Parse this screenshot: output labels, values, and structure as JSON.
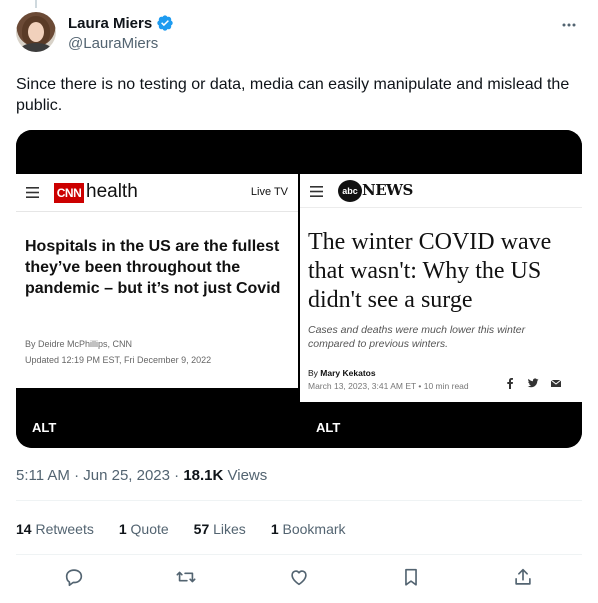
{
  "author": {
    "display_name": "Laura Miers",
    "handle": "@LauraMiers",
    "verified": true
  },
  "tweet": {
    "text": "Since there is no testing or data, media can easily manipulate and mislead the public."
  },
  "media": [
    {
      "site_section": "health",
      "logo_text": "CNN",
      "nav_link": "Live TV",
      "headline": "Hospitals in the US are the fullest they’ve been throughout the pandemic – but it’s not just Covid",
      "byline": "By Deidre McPhillips, CNN",
      "updated": "Updated 12:19 PM EST, Fri December 9, 2022",
      "alt_label": "ALT"
    },
    {
      "logo_text": "abc",
      "site_name": "NEWS",
      "headline": "The winter COVID wave that wasn't: Why the US didn't see a surge",
      "subheadline": "Cases and deaths were much lower this winter compared to previous winters.",
      "byline_prefix": "By",
      "byline_name": "Mary Kekatos",
      "date": "March 13, 2023, 3:41 AM ET • 10 min read",
      "alt_label": "ALT"
    }
  ],
  "meta": {
    "time": "5:11 AM · Jun 25, 2023 · ",
    "views_count": "18.1K",
    "views_label": " Views"
  },
  "stats": [
    {
      "count": "14",
      "label": "Retweets"
    },
    {
      "count": "1",
      "label": "Quote"
    },
    {
      "count": "57",
      "label": "Likes"
    },
    {
      "count": "1",
      "label": "Bookmark"
    }
  ],
  "colors": {
    "text_primary": "#0f1419",
    "text_secondary": "#536471",
    "verified_blue": "#1d9bf0",
    "cnn_red": "#cc0000"
  },
  "icons": [
    "verified-icon",
    "more-icon",
    "reply-icon",
    "retweet-icon",
    "like-icon",
    "bookmark-icon",
    "share-icon"
  ]
}
